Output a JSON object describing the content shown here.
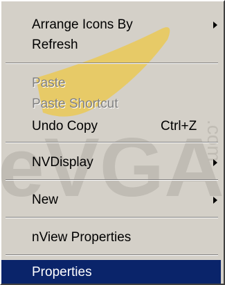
{
  "menu": {
    "items": [
      {
        "label": "Arrange Icons By",
        "submenu": true,
        "enabled": true
      },
      {
        "label": "Refresh",
        "enabled": true
      },
      {
        "label": "Paste",
        "enabled": false
      },
      {
        "label": "Paste Shortcut",
        "enabled": false
      },
      {
        "label": "Undo Copy",
        "shortcut": "Ctrl+Z",
        "enabled": true
      },
      {
        "label": "NVDisplay",
        "submenu": true,
        "enabled": true
      },
      {
        "label": "New",
        "submenu": true,
        "enabled": true
      },
      {
        "label": "nView Properties",
        "enabled": true
      },
      {
        "label": "Properties",
        "enabled": true,
        "selected": true
      }
    ]
  },
  "watermark": {
    "text": "eVGA",
    "suffix": ".com",
    "color": "#bdb9b1",
    "accent_color": "#f5c518"
  },
  "colors": {
    "menu_bg": "#d4d0c8",
    "selection_bg": "#0a246a",
    "disabled_text": "#808080"
  }
}
